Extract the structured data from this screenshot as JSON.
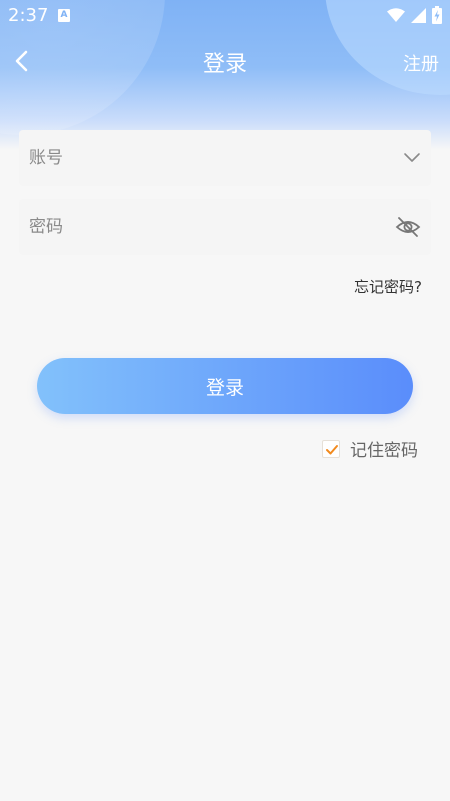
{
  "status_bar": {
    "time": "2:37",
    "notification_icon": "a-letter-icon",
    "wifi_icon": "wifi-icon",
    "signal_icon": "signal-icon",
    "battery_icon": "battery-charging-icon"
  },
  "nav": {
    "back_icon": "chevron-left-icon",
    "title": "登录",
    "register_label": "注册"
  },
  "form": {
    "account": {
      "placeholder": "账号",
      "value": "",
      "dropdown_icon": "chevron-down-icon"
    },
    "password": {
      "placeholder": "密码",
      "value": "",
      "visibility_icon": "eye-off-icon"
    },
    "forgot_label": "忘记密码?",
    "login_label": "登录",
    "remember": {
      "label": "记住密码",
      "checked": true
    }
  },
  "colors": {
    "header_gradient_top": "#7fb2f5",
    "button_gradient_start": "#82c1fb",
    "button_gradient_end": "#5a8dfb",
    "checkmark": "#f28a1e",
    "background": "#f7f7f7"
  }
}
